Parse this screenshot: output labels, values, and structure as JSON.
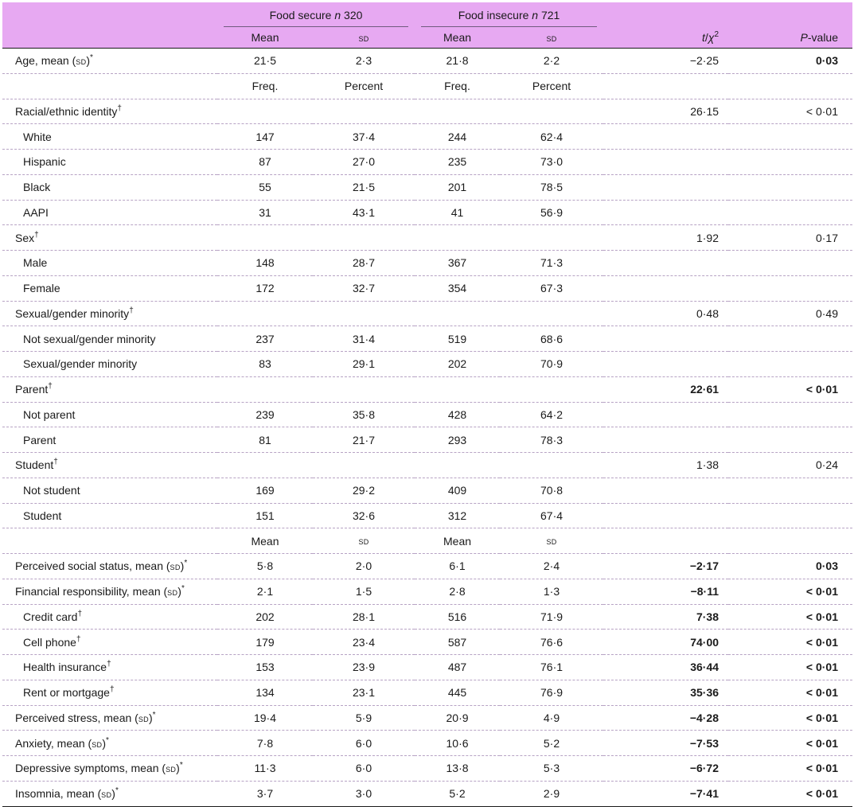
{
  "header": {
    "group_food_secure": "Food secure",
    "group_food_secure_n": "320",
    "group_food_insecure": "Food insecure",
    "group_food_insecure_n": "721",
    "n_label": "n",
    "mean": "Mean",
    "sd": "SD",
    "stat_t": "t",
    "stat_sep": "/",
    "stat_chi": "χ",
    "stat_chi_sup": "2",
    "p_prefix": "P",
    "p_suffix": "-value"
  },
  "subheaders": {
    "freq": "Freq.",
    "percent": "Percent",
    "mean": "Mean",
    "sd": "SD"
  },
  "rows": [
    {
      "label": "Age, mean (",
      "sd": "SD",
      "label_close": ")",
      "sup": "*",
      "v1": "21·5",
      "v2": "2·3",
      "v3": "21·8",
      "v4": "2·2",
      "stat": "−2·25",
      "p": "0·03"
    },
    {
      "label": "Racial/ethnic identity",
      "sup": "†",
      "stat": "26·15",
      "p": "< 0·01"
    },
    {
      "label": "White",
      "v1": "147",
      "v2": "37·4",
      "v3": "244",
      "v4": "62·4"
    },
    {
      "label": "Hispanic",
      "v1": "87",
      "v2": "27·0",
      "v3": "235",
      "v4": "73·0"
    },
    {
      "label": "Black",
      "v1": "55",
      "v2": "21·5",
      "v3": "201",
      "v4": "78·5"
    },
    {
      "label": "AAPI",
      "v1": "31",
      "v2": "43·1",
      "v3": "41",
      "v4": "56·9"
    },
    {
      "label": "Sex",
      "sup": "†",
      "stat": "1·92",
      "p": "0·17"
    },
    {
      "label": "Male",
      "v1": "148",
      "v2": "28·7",
      "v3": "367",
      "v4": "71·3"
    },
    {
      "label": "Female",
      "v1": "172",
      "v2": "32·7",
      "v3": "354",
      "v4": "67·3"
    },
    {
      "label": "Sexual/gender minority",
      "sup": "†",
      "stat": "0·48",
      "p": "0·49"
    },
    {
      "label": "Not sexual/gender minority",
      "v1": "237",
      "v2": "31·4",
      "v3": "519",
      "v4": "68·6"
    },
    {
      "label": "Sexual/gender minority",
      "v1": "83",
      "v2": "29·1",
      "v3": "202",
      "v4": "70·9"
    },
    {
      "label": "Parent",
      "sup": "†",
      "stat": "22·61",
      "p": "< 0·01"
    },
    {
      "label": "Not parent",
      "v1": "239",
      "v2": "35·8",
      "v3": "428",
      "v4": "64·2"
    },
    {
      "label": "Parent",
      "v1": "81",
      "v2": "21·7",
      "v3": "293",
      "v4": "78·3"
    },
    {
      "label": "Student",
      "sup": "†",
      "stat": "1·38",
      "p": "0·24"
    },
    {
      "label": "Not student",
      "v1": "169",
      "v2": "29·2",
      "v3": "409",
      "v4": "70·8"
    },
    {
      "label": "Student",
      "v1": "151",
      "v2": "32·6",
      "v3": "312",
      "v4": "67·4"
    },
    {
      "label": "Perceived social status, mean (",
      "sd": "SD",
      "label_close": ")",
      "sup": "*",
      "v1": "5·8",
      "v2": "2·0",
      "v3": "6·1",
      "v4": "2·4",
      "stat": "−2·17",
      "p": "0·03"
    },
    {
      "label": "Financial responsibility, mean (",
      "sd": "SD",
      "label_close": ")",
      "sup": "*",
      "v1": "2·1",
      "v2": "1·5",
      "v3": "2·8",
      "v4": "1·3",
      "stat": "−8·11",
      "p": "< 0·01"
    },
    {
      "label": "Credit card",
      "sup": "†",
      "v1": "202",
      "v2": "28·1",
      "v3": "516",
      "v4": "71·9",
      "stat": "7·38",
      "p": "< 0·01"
    },
    {
      "label": "Cell phone",
      "sup": "†",
      "v1": "179",
      "v2": "23·4",
      "v3": "587",
      "v4": "76·6",
      "stat": "74·00",
      "p": "< 0·01"
    },
    {
      "label": "Health insurance",
      "sup": "†",
      "v1": "153",
      "v2": "23·9",
      "v3": "487",
      "v4": "76·1",
      "stat": "36·44",
      "p": "< 0·01"
    },
    {
      "label": "Rent or mortgage",
      "sup": "†",
      "v1": "134",
      "v2": "23·1",
      "v3": "445",
      "v4": "76·9",
      "stat": "35·36",
      "p": "< 0·01"
    },
    {
      "label": "Perceived stress, mean (",
      "sd": "SD",
      "label_close": ")",
      "sup": "*",
      "v1": "19·4",
      "v2": "5·9",
      "v3": "20·9",
      "v4": "4·9",
      "stat": "−4·28",
      "p": "< 0·01"
    },
    {
      "label": "Anxiety, mean (",
      "sd": "SD",
      "label_close": ")",
      "sup": "*",
      "v1": "7·8",
      "v2": "6·0",
      "v3": "10·6",
      "v4": "5·2",
      "stat": "−7·53",
      "p": "< 0·01"
    },
    {
      "label": "Depressive symptoms, mean (",
      "sd": "SD",
      "label_close": ")",
      "sup": "*",
      "v1": "11·3",
      "v2": "6·0",
      "v3": "13·8",
      "v4": "5·3",
      "stat": "−6·72",
      "p": "< 0·01"
    },
    {
      "label": "Insomnia, mean (",
      "sd": "SD",
      "label_close": ")",
      "sup": "*",
      "v1": "3·7",
      "v2": "3·0",
      "v3": "5·2",
      "v4": "2·9",
      "stat": "−7·41",
      "p": "< 0·01"
    }
  ],
  "style": {
    "header_bg": "#e7a9f2",
    "row_rule": "#b7a3c4",
    "text": "#1a1a1a"
  }
}
